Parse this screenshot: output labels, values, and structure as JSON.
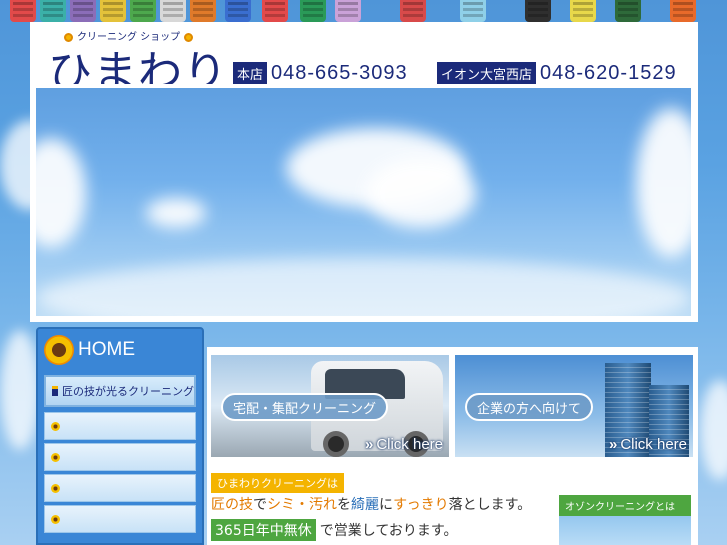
{
  "logo": {
    "subtitle": "クリーニング ショップ",
    "name": "ひまわり"
  },
  "header": {
    "phones": [
      {
        "tag": "本店",
        "number": "048-665-3093"
      },
      {
        "tag": "イオン大宮西店",
        "number": "048-620-1529"
      }
    ]
  },
  "sidebar": {
    "home_label": "HOME",
    "items": [
      {
        "label": "匠の技が光るクリーニング"
      },
      {
        "label": ""
      },
      {
        "label": ""
      },
      {
        "label": ""
      },
      {
        "label": ""
      }
    ]
  },
  "banners": [
    {
      "label": "宅配・集配クリーニング",
      "click": "Click here"
    },
    {
      "label": "企業の方へ向けて",
      "click": "Click here"
    }
  ],
  "intro": {
    "tag": "ひまわりクリーニングは",
    "line1": {
      "a": "匠の技",
      "b": "で",
      "c": "シミ・汚れ",
      "d": "を",
      "e": "綺麗",
      "f": "に",
      "g": "すっきり",
      "h": "落とします。"
    },
    "line2": {
      "highlight": "365日年中無休",
      "rest": "で営業しております。"
    }
  },
  "ozone": {
    "title": "オゾンクリーニングとは"
  }
}
